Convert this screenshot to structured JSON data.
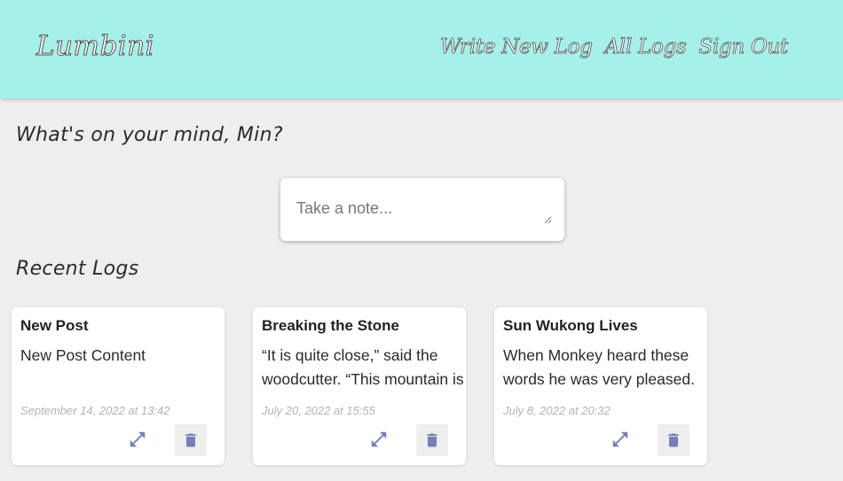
{
  "header": {
    "brand": "Lumbini",
    "nav": [
      {
        "label": "Write New Log"
      },
      {
        "label": "All Logs"
      },
      {
        "label": "Sign Out"
      }
    ],
    "background_color": "#a5f0e9"
  },
  "main": {
    "prompt": "What's on your mind, Min?",
    "note_input": {
      "placeholder": "Take a note...",
      "value": ""
    },
    "recent_heading": "Recent Logs",
    "logs": [
      {
        "title": "New Post",
        "body": "New Post Content",
        "date": "September 14, 2022 at 13:42"
      },
      {
        "title": "Breaking the Stone",
        "body": "“It is quite close,” said the woodcutter. “This mountain is",
        "date": "July 20, 2022 at 15:55"
      },
      {
        "title": "Sun Wukong Lives",
        "body": "When Monkey heard these words he was very pleased.",
        "date": "July 8, 2022 at 20:32"
      }
    ]
  },
  "icons": {
    "expand": "expand-icon",
    "delete": "trash-icon",
    "icon_color": "#7480b8"
  }
}
